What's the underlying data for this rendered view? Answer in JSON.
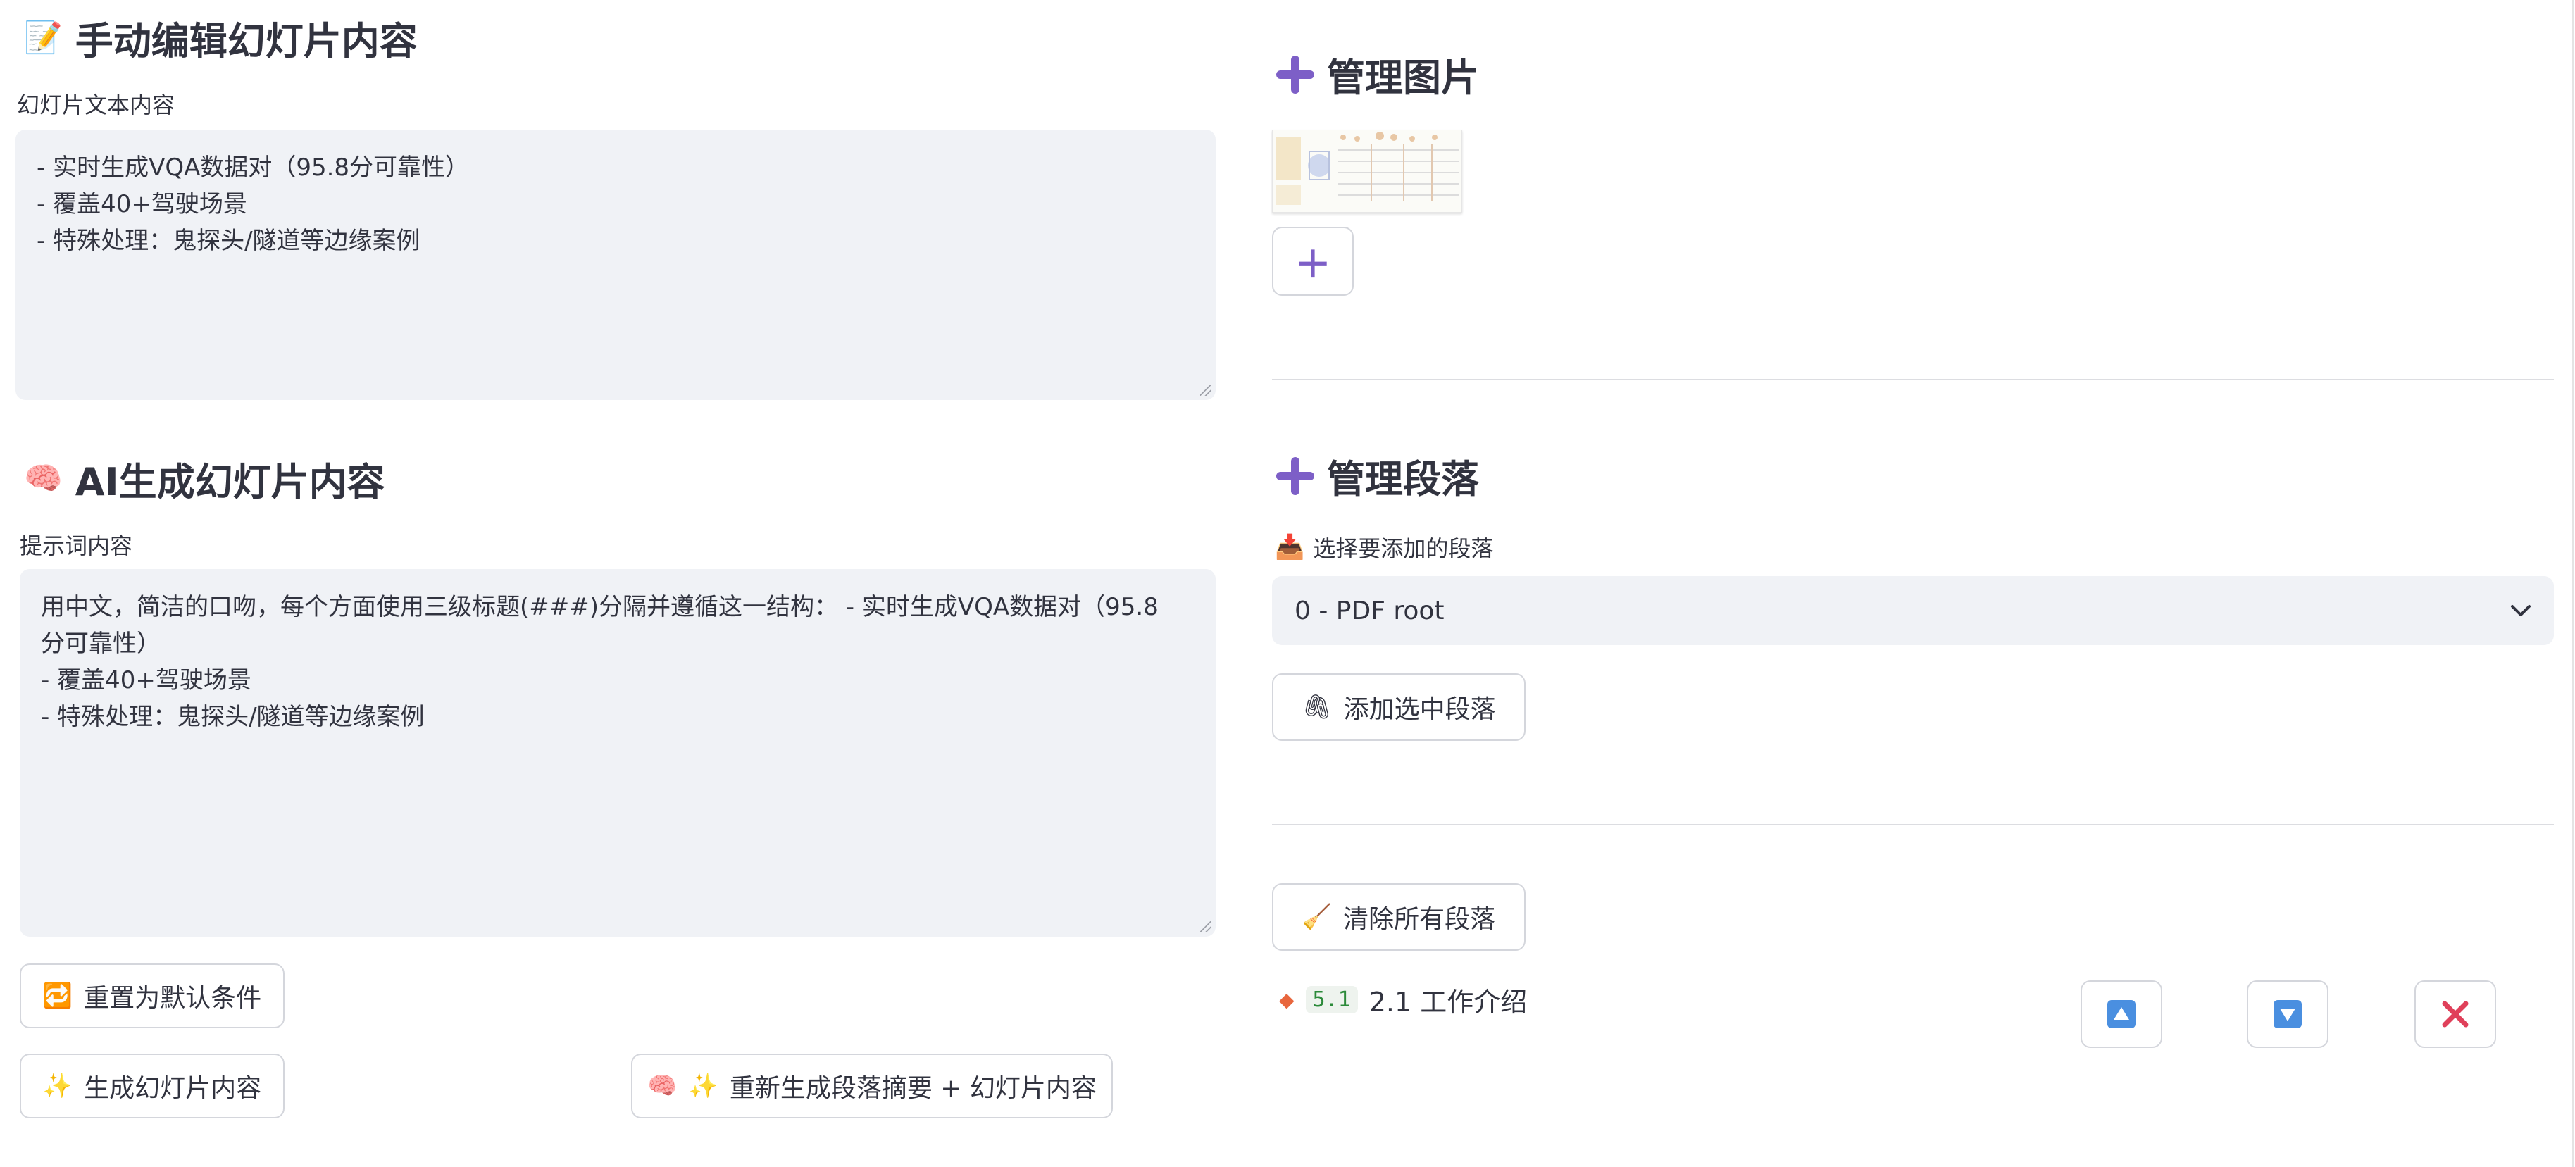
{
  "manual_edit": {
    "title": "手动编辑幻灯片内容",
    "icon": "memo-icon",
    "field_label": "幻灯片文本内容",
    "lines": [
      "- 实时生成VQA数据对（95.8分可靠性）",
      "- 覆盖40+驾驶场景",
      "- 特殊处理：鬼探头/隧道等边缘案例"
    ]
  },
  "ai_generate": {
    "title": "AI生成幻灯片内容",
    "icon": "brain-icon",
    "field_label": "提示词内容",
    "lines": [
      "用中文，简洁的口吻，每个方面使用三级标题(###)分隔并遵循这一结构： - 实时生成VQA数据对（95.8",
      "分可靠性）",
      "- 覆盖40+驾驶场景",
      "- 特殊处理：鬼探头/隧道等边缘案例"
    ],
    "reset_button": "重置为默认条件",
    "generate_button": "生成幻灯片内容",
    "regenerate_button": "重新生成段落摘要 + 幻灯片内容"
  },
  "images": {
    "title": "管理图片",
    "icon": "plus-icon",
    "add_button_icon": "plus-icon"
  },
  "paragraphs": {
    "title": "管理段落",
    "select_label": "选择要添加的段落",
    "select_value": "0 - PDF root",
    "add_button": "添加选中段落",
    "clear_button": "清除所有段落",
    "items": [
      {
        "number": "5.1",
        "title": "2.1 工作介绍"
      }
    ]
  },
  "colors": {
    "accent_purple": "#7d5fc7",
    "field_bg": "#f0f2f6",
    "code_green": "#2c8a3a",
    "delete_red": "#e0405a",
    "arrow_blue": "#4a8fe0"
  }
}
